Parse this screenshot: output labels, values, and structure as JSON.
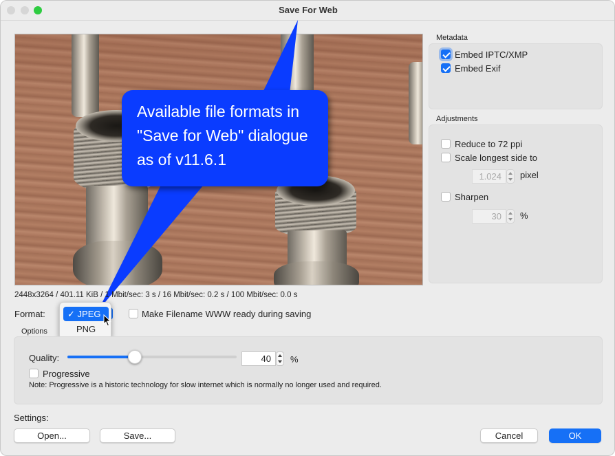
{
  "window": {
    "title": "Save For Web"
  },
  "preview": {
    "info": "2448x3264 / 401.11 KiB / 1 Mbit/sec: 3 s / 16 Mbit/sec: 0.2 s / 100 Mbit/sec: 0.0 s",
    "callout_lines": [
      "Available file formats in",
      "\"Save for Web\" dialogue",
      "as of v11.6.1"
    ]
  },
  "format": {
    "label": "Format:",
    "options": [
      {
        "label": "JPEG",
        "checkmark": "✓",
        "selected": true
      },
      {
        "label": "PNG",
        "selected": false
      }
    ],
    "www_ready_label": "Make Filename WWW ready during saving",
    "www_ready_checked": false
  },
  "options": {
    "title": "Options",
    "quality_label": "Quality:",
    "quality_value": "40",
    "quality_unit": "%",
    "quality_fraction": 0.4,
    "progressive_label": "Progressive",
    "progressive_checked": false,
    "note": "Note: Progressive is a historic technology for slow internet which is normally no longer used and required."
  },
  "metadata": {
    "title": "Metadata",
    "embed_iptc_label": "Embed IPTC/XMP",
    "embed_iptc_checked": true,
    "embed_exif_label": "Embed Exif",
    "embed_exif_checked": true
  },
  "adjustments": {
    "title": "Adjustments",
    "reduce_label": "Reduce to 72 ppi",
    "reduce_checked": false,
    "scale_label": "Scale longest side to",
    "scale_checked": false,
    "scale_value": "1.024",
    "scale_unit": "pixel",
    "sharpen_label": "Sharpen",
    "sharpen_checked": false,
    "sharpen_value": "30",
    "sharpen_unit": "%"
  },
  "settings": {
    "label": "Settings:",
    "open_label": "Open...",
    "save_label": "Save..."
  },
  "footer": {
    "cancel_label": "Cancel",
    "ok_label": "OK"
  },
  "colors": {
    "accent": "#1670f6",
    "callout": "#0a3cff"
  },
  "icons": {
    "close": "close-icon",
    "minimize": "minimize-icon",
    "maximize": "maximize-icon",
    "cursor": "pointer-cursor-icon"
  }
}
